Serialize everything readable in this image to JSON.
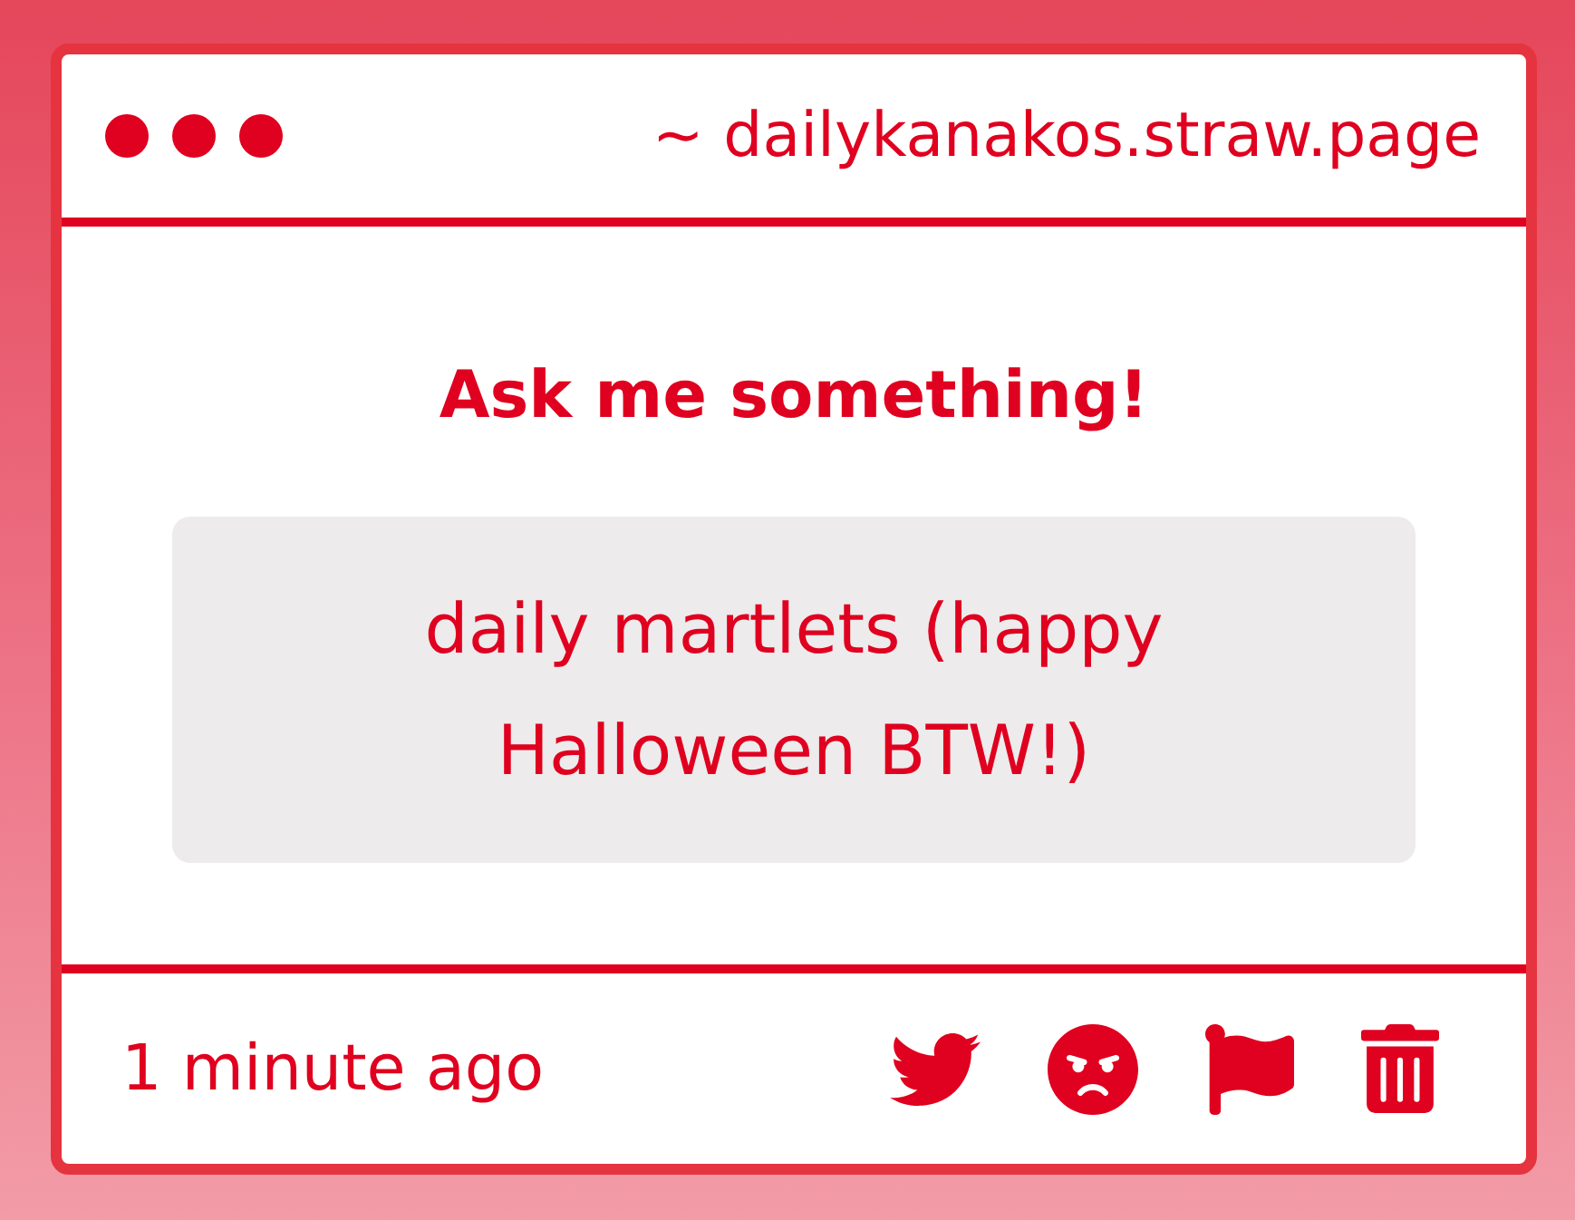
{
  "window": {
    "title": "~ dailykanakos.straw.page"
  },
  "heading": "Ask me something!",
  "question": {
    "text": "daily martlets (happy Halloween BTW!)"
  },
  "footer": {
    "time": "1 minute ago",
    "actions": [
      {
        "kind": "bird"
      },
      {
        "kind": "angry"
      },
      {
        "kind": "flag"
      },
      {
        "kind": "trash"
      }
    ]
  }
}
